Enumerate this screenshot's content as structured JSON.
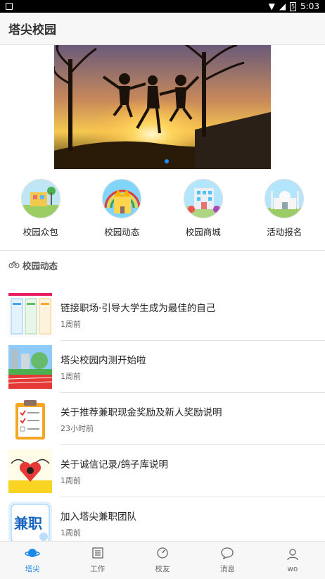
{
  "status": {
    "time": "5:03",
    "battery": "5"
  },
  "app": {
    "title": "塔尖校园"
  },
  "grid": [
    {
      "label": "校园众包",
      "icon": "crowdsource-icon"
    },
    {
      "label": "校园动态",
      "icon": "castle-icon"
    },
    {
      "label": "校园商城",
      "icon": "mall-icon"
    },
    {
      "label": "活动报名",
      "icon": "building-icon"
    }
  ],
  "section": {
    "title": "校园动态",
    "icon": "bicycle-icon"
  },
  "feed": [
    {
      "title": "链接职场·引导大学生成为最佳的自己",
      "time": "1周前"
    },
    {
      "title": "塔尖校园内测开始啦",
      "time": "1周前"
    },
    {
      "title": "关于推荐兼职现金奖励及新人奖励说明",
      "time": "23小时前"
    },
    {
      "title": "关于诚信记录/鸽子库说明",
      "time": "1周前"
    },
    {
      "title": "加入塔尖兼职团队",
      "time": "1周前"
    }
  ],
  "tabs": [
    {
      "label": "塔尖",
      "icon": "planet-icon",
      "active": true
    },
    {
      "label": "工作",
      "icon": "list-icon"
    },
    {
      "label": "校友",
      "icon": "compass-icon"
    },
    {
      "label": "消息",
      "icon": "chat-icon"
    },
    {
      "label": "wo",
      "icon": "person-icon"
    }
  ],
  "colors": {
    "accent": "#1e88e5",
    "appbar": "#f7f7f7"
  }
}
